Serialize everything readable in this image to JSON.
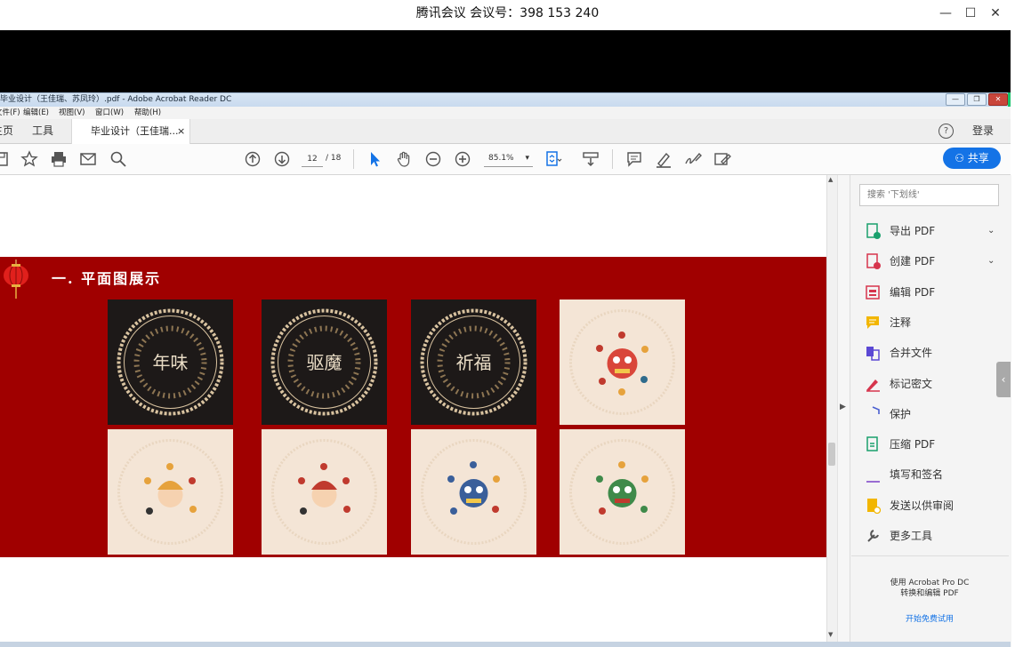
{
  "meeting": {
    "title": "腾讯会议 会议号：398 153 240",
    "minimize": "—",
    "restore": "☐",
    "close": "✕"
  },
  "acrobat": {
    "window_title": "毕业设计（王佳瑞、苏凤玲）.pdf - Adobe Acrobat Reader DC",
    "menu": [
      "文件(F)",
      "编辑(E)",
      "视图(V)",
      "窗口(W)",
      "帮助(H)"
    ],
    "tabs": {
      "home": "主页",
      "tools": "工具",
      "document": "毕业设计（王佳瑞...",
      "close": "×"
    },
    "help": "?",
    "login": "登录"
  },
  "toolbar": {
    "page_current": "12",
    "page_total": "/ 18",
    "zoom": "85.1%",
    "zoom_arrow": "▾",
    "share_label": "共享"
  },
  "document": {
    "slide_heading": "一. 平面图展示",
    "art_top": [
      {
        "text": "年味",
        "theme": "dark"
      },
      {
        "text": "驱魔",
        "theme": "dark"
      },
      {
        "text": "祈福",
        "theme": "dark"
      },
      {
        "text": "",
        "theme": "light"
      }
    ],
    "art_bottom": [
      {
        "theme": "light"
      },
      {
        "theme": "light"
      },
      {
        "theme": "light"
      },
      {
        "theme": "light"
      }
    ]
  },
  "right_pane": {
    "search_placeholder": "搜索 '下划线'",
    "items": [
      {
        "label": "导出 PDF",
        "icon": "export-pdf-icon",
        "color": "#1aa06d",
        "chevron": "⌄"
      },
      {
        "label": "创建 PDF",
        "icon": "create-pdf-icon",
        "color": "#d6354d",
        "chevron": "⌄"
      },
      {
        "label": "编辑 PDF",
        "icon": "edit-pdf-icon",
        "color": "#d6354d",
        "chevron": ""
      },
      {
        "label": "注释",
        "icon": "comment-icon",
        "color": "#f2b600",
        "chevron": ""
      },
      {
        "label": "合并文件",
        "icon": "combine-files-icon",
        "color": "#5b48d4",
        "chevron": ""
      },
      {
        "label": "标记密文",
        "icon": "redact-icon",
        "color": "#d6354d",
        "chevron": ""
      },
      {
        "label": "保护",
        "icon": "protect-icon",
        "color": "#4a5fd0",
        "chevron": ""
      },
      {
        "label": "压缩 PDF",
        "icon": "compress-pdf-icon",
        "color": "#1aa06d",
        "chevron": ""
      },
      {
        "label": "填写和签名",
        "icon": "fill-sign-icon",
        "color": "#7b3fc7",
        "chevron": ""
      },
      {
        "label": "发送以供审阅",
        "icon": "send-review-icon",
        "color": "#f2b600",
        "chevron": ""
      },
      {
        "label": "更多工具",
        "icon": "more-tools-icon",
        "color": "#555555",
        "chevron": ""
      }
    ],
    "promo_line1": "使用 Acrobat Pro DC",
    "promo_line2": "转换和编辑 PDF",
    "promo_link": "开始免费试用",
    "handle": "‹"
  },
  "colors": {
    "slide_red": "#a00000",
    "accent_blue": "#1473e6",
    "meeting_green": "#17c36b"
  }
}
